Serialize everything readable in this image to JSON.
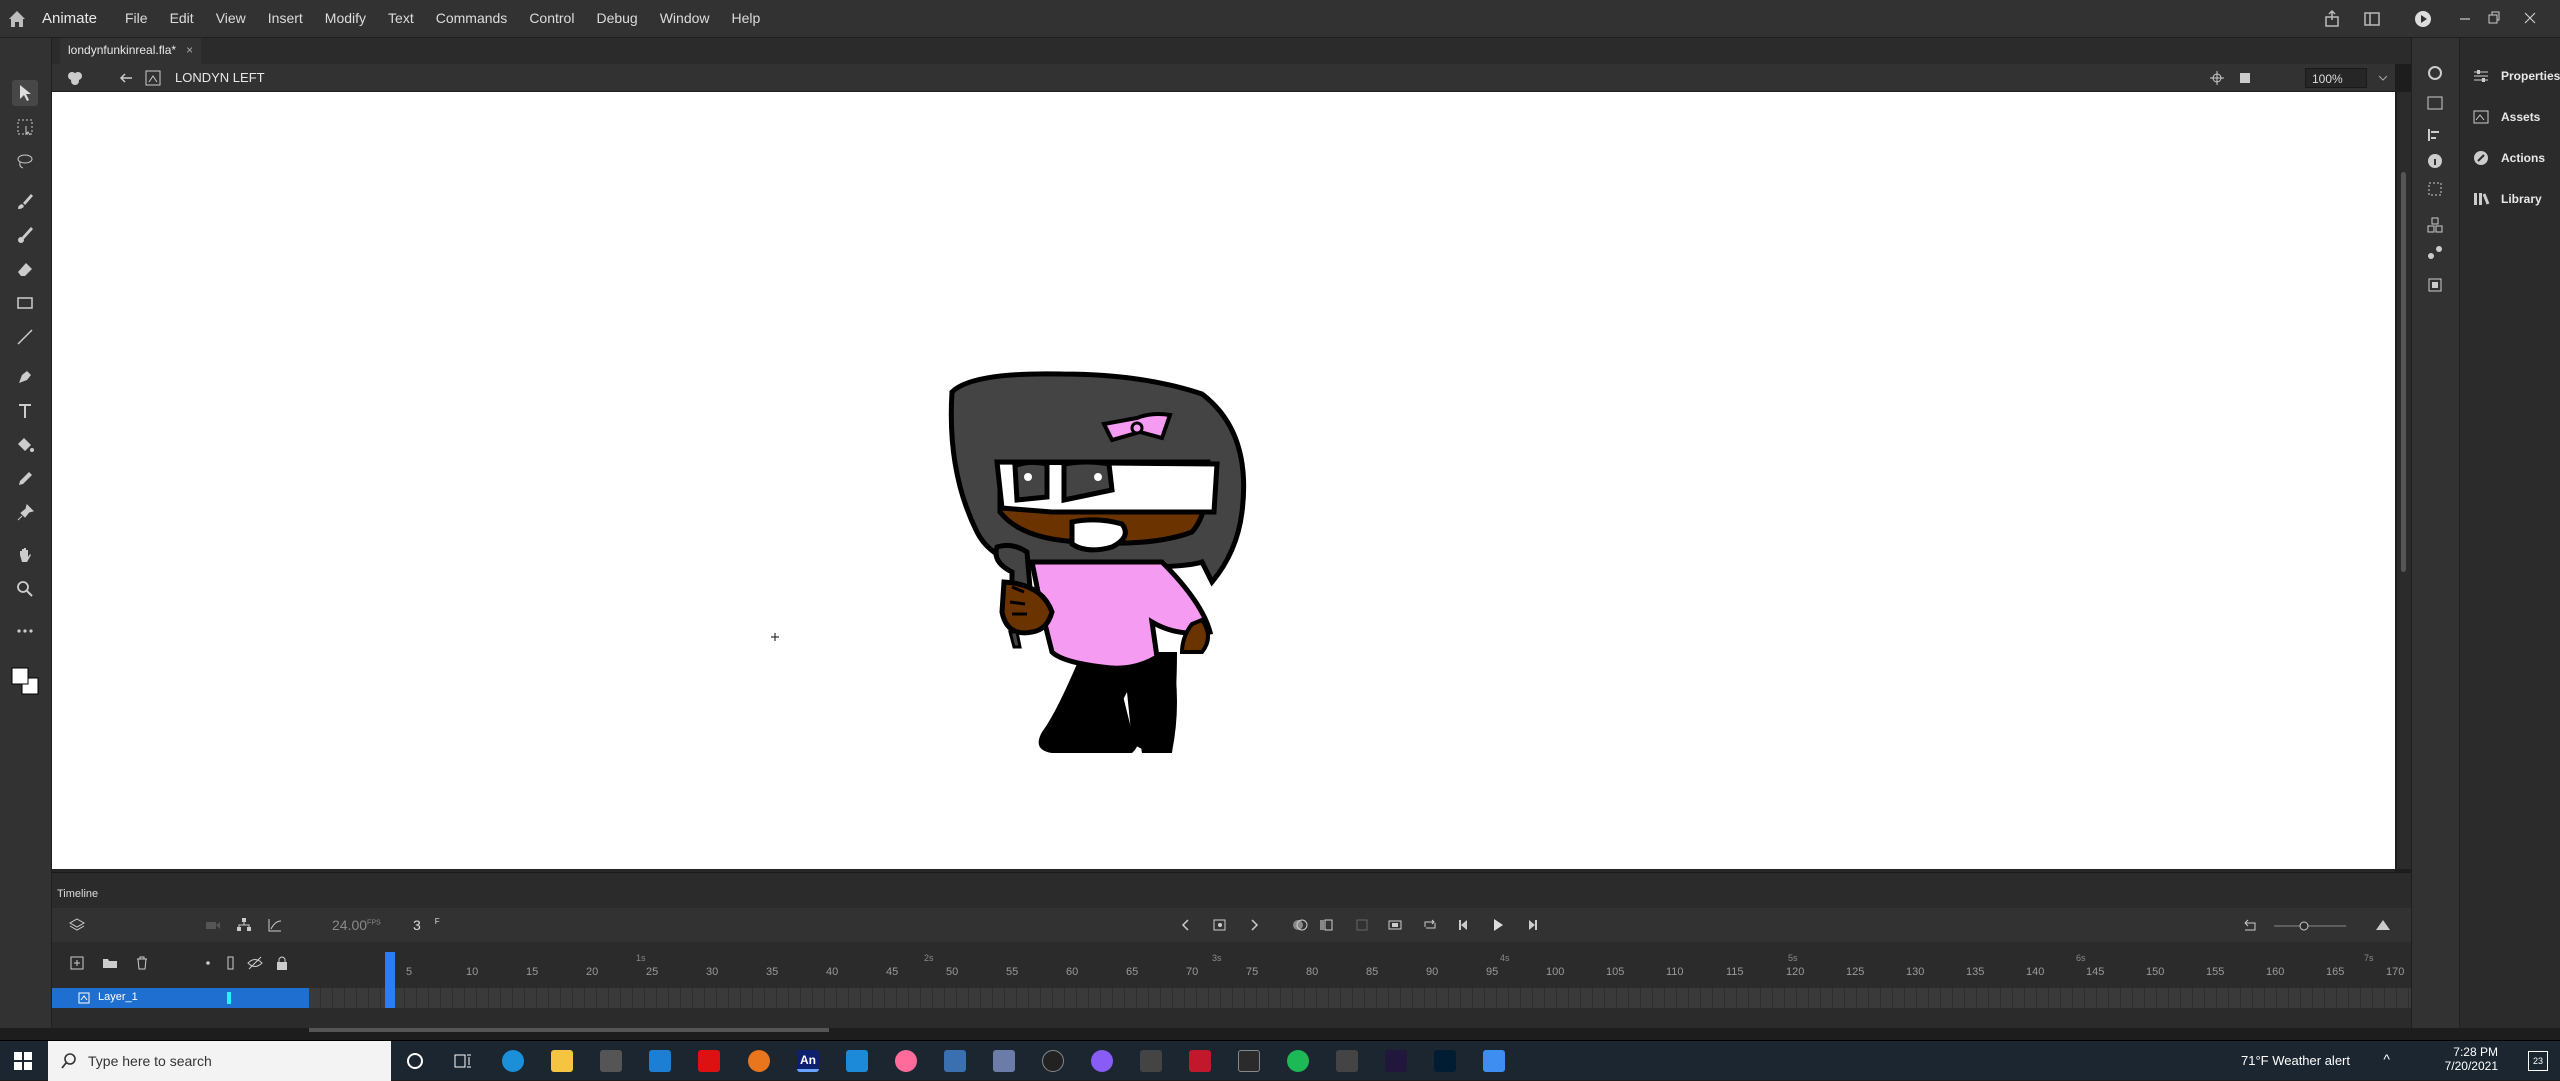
{
  "app": {
    "name": "Animate"
  },
  "menu": [
    "File",
    "Edit",
    "View",
    "Insert",
    "Modify",
    "Text",
    "Commands",
    "Control",
    "Debug",
    "Window",
    "Help"
  ],
  "document": {
    "tab": "londynfunkinreal.fla*",
    "scene": "LONDYN LEFT",
    "zoom": "100%"
  },
  "timeline": {
    "title": "Timeline",
    "fps": "24.00",
    "fps_unit": "FPS",
    "current_frame": "3",
    "frame_suffix": "F",
    "layer": {
      "name": "Layer_1"
    },
    "ruler_ticks": [
      "5",
      "10",
      "15",
      "20",
      "25",
      "30",
      "35",
      "40",
      "45",
      "50",
      "55",
      "60",
      "65",
      "70",
      "75",
      "80",
      "85",
      "90",
      "95",
      "100",
      "105",
      "110",
      "115",
      "120",
      "125",
      "130",
      "135",
      "140",
      "145",
      "150",
      "155",
      "160",
      "165",
      "170"
    ],
    "seconds": [
      "1s",
      "2s",
      "3s",
      "4s",
      "5s",
      "6s",
      "7s"
    ]
  },
  "panels": [
    "Properties",
    "Assets",
    "Actions",
    "Library"
  ],
  "taskbar": {
    "search_placeholder": "Type here to search",
    "weather": "71°F  Weather alert",
    "time": "7:28 PM",
    "date": "7/20/2021",
    "notifications": "23"
  },
  "colors": {
    "skin": "#6b3300",
    "shirt": "#f59bf2",
    "hair": "#444444",
    "accent": "#2f7cf2"
  }
}
